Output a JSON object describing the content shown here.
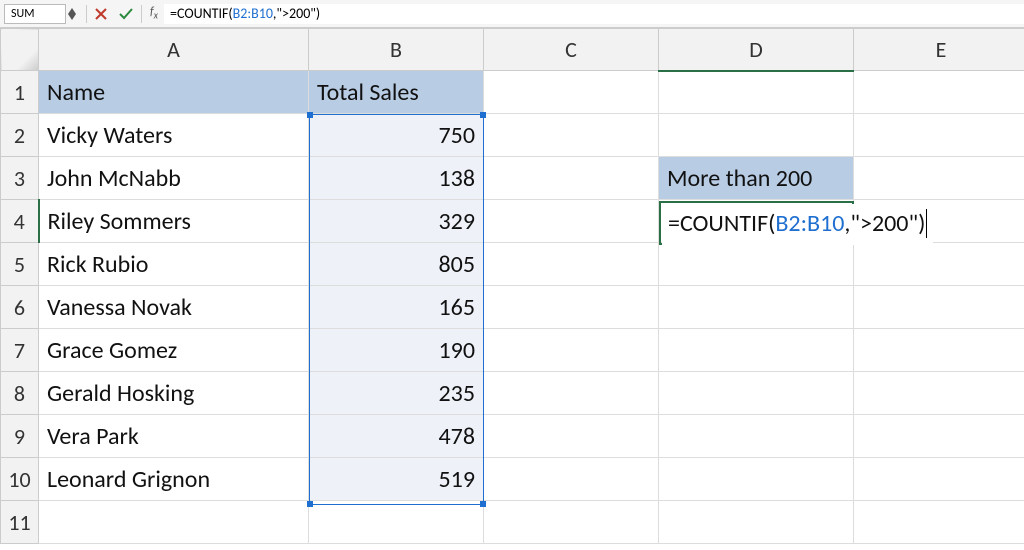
{
  "formula_bar": {
    "name_box": "SUM",
    "formula_prefix": "=COUNTIF(",
    "formula_ref": "B2:B10",
    "formula_suffix": ",\">200\")"
  },
  "columns": [
    "A",
    "B",
    "C",
    "D",
    "E"
  ],
  "row_numbers": [
    "1",
    "2",
    "3",
    "4",
    "5",
    "6",
    "7",
    "8",
    "9",
    "10",
    "11"
  ],
  "headers": {
    "A": "Name",
    "B": "Total Sales"
  },
  "rows": [
    {
      "name": "Vicky Waters",
      "sales": "750"
    },
    {
      "name": "John McNabb",
      "sales": "138"
    },
    {
      "name": "Riley Sommers",
      "sales": "329"
    },
    {
      "name": "Rick Rubio",
      "sales": "805"
    },
    {
      "name": "Vanessa Novak",
      "sales": "165"
    },
    {
      "name": "Grace Gomez",
      "sales": "190"
    },
    {
      "name": "Gerald Hosking",
      "sales": "235"
    },
    {
      "name": "Vera Park",
      "sales": "478"
    },
    {
      "name": "Leonard Grignon",
      "sales": "519"
    }
  ],
  "d3_label": "More than 200",
  "active_cell": {
    "address": "D4",
    "display_prefix": "=COUNTIF(",
    "display_ref": "B2:B10",
    "display_suffix": ",\">200\")"
  },
  "colors": {
    "header_fill": "#b8cce4",
    "range_fill": "#eef2f8",
    "range_border": "#1f6fd0",
    "active_border": "#2b6f46"
  }
}
